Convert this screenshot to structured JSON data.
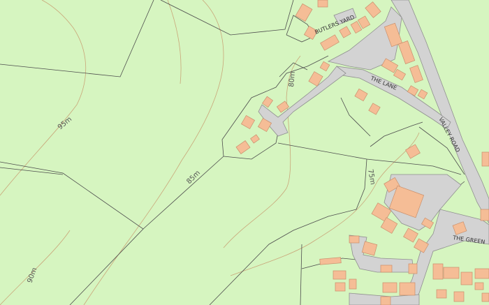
{
  "map": {
    "colors": {
      "land": "#d6f5c0",
      "building": "#f5bd96",
      "building_edge": "#c98f6b",
      "road": "#d3d3d3",
      "road_edge": "#8f8f8f",
      "boundary": "#4d4d4d",
      "contour": "#c9a679",
      "label": "#555555"
    },
    "contour_labels": {
      "c95": "95m",
      "c85": "85m",
      "c80": "80m",
      "c75": "75m",
      "c90": "90m"
    },
    "road_labels": {
      "butlers_yard": "BUTLERS YARD",
      "the_lane": "THE LANE",
      "valley_road": "VALLEY ROAD",
      "the_green": "THE GREEN"
    }
  }
}
